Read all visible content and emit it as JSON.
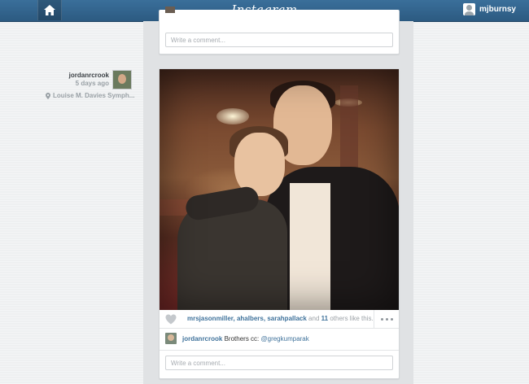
{
  "header": {
    "logo_text": "Instagram",
    "username": "mjburnsy",
    "home_icon": "home-icon",
    "accent_color": "#2f6189"
  },
  "post_previous": {
    "comment_placeholder": "Write a comment..."
  },
  "post": {
    "author": "jordanrcrook",
    "time_ago": "5 days ago",
    "location": "Louise M. Davies Symph...",
    "likes": {
      "users": [
        "mrsjasonmiller",
        "ahalbers",
        "sarahpallack"
      ],
      "sep1": ",",
      "sep2": ",",
      "and_text": "and",
      "others_count": "11",
      "others_text": "others like this."
    },
    "caption": {
      "author": "jordanrcrook",
      "text": "Brothers cc:",
      "mention": "@gregkumparak"
    },
    "comment_placeholder": "Write a comment..."
  }
}
